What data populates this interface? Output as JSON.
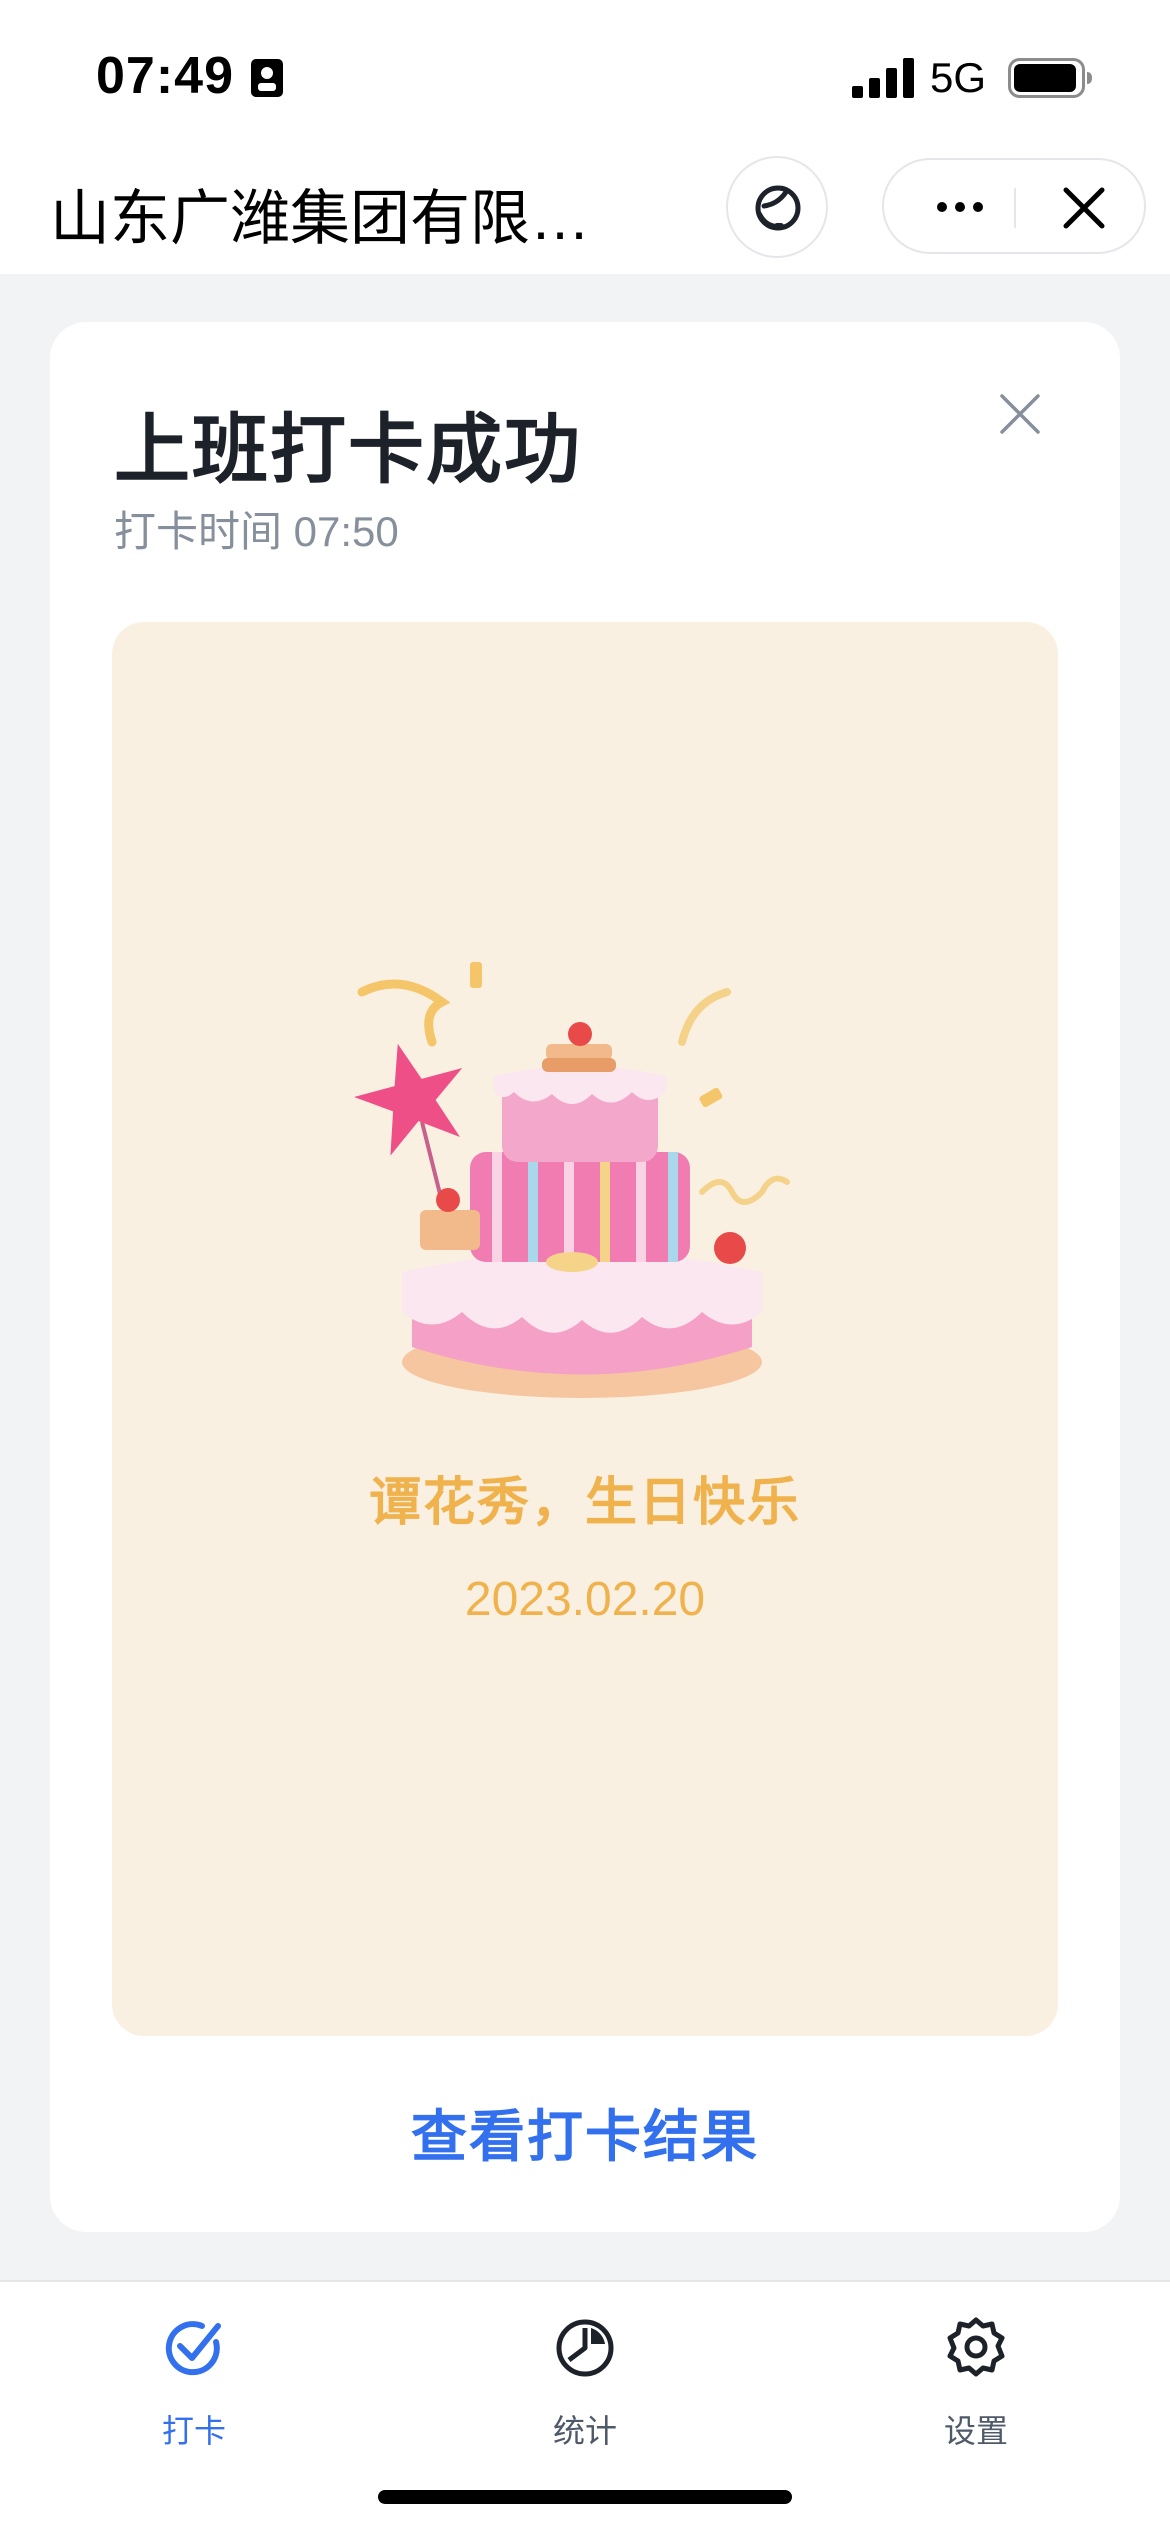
{
  "status_bar": {
    "time": "07:49",
    "network": "5G"
  },
  "nav": {
    "title": "山东广潍集团有限…",
    "icons": [
      "customer-service-icon",
      "more-icon",
      "close-icon"
    ]
  },
  "card": {
    "title": "上班打卡成功",
    "time_label": "打卡时间 07:50",
    "birthday": {
      "greeting": "谭花秀，生日快乐",
      "date": "2023.02.20"
    },
    "action_label": "查看打卡结果"
  },
  "tabs": [
    {
      "label": "打卡",
      "icon": "check-icon",
      "active": true
    },
    {
      "label": "统计",
      "icon": "pie-chart-icon",
      "active": false
    },
    {
      "label": "设置",
      "icon": "gear-icon",
      "active": false
    }
  ],
  "colors": {
    "accent": "#3370EE",
    "birthday_text": "#F0B24C",
    "birthday_panel": "#FAF0E2",
    "page_bg": "#F2F3F5"
  }
}
